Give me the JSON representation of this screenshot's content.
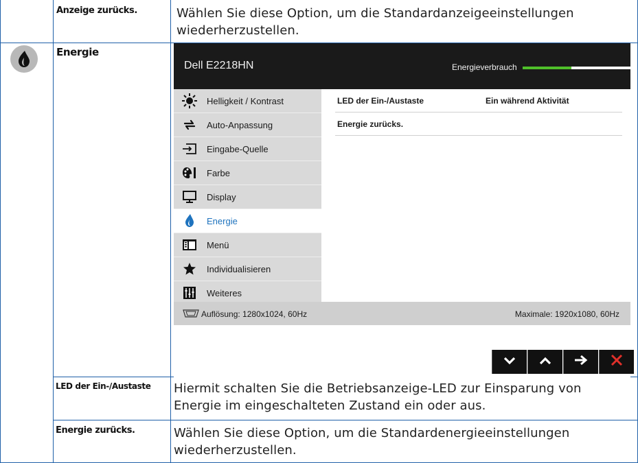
{
  "rows": {
    "reset_display": {
      "label": "Anzeige zurücks.",
      "description": "Wählen Sie diese Option, um die Standardanzeigeeinstellungen wiederherzustellen."
    },
    "energy": {
      "label": "Energie",
      "icon": "energy-flame-icon"
    },
    "power_led": {
      "label": "LED der Ein-/Austaste",
      "description": "Hiermit schalten Sie die Betriebsanzeige-LED zur Einsparung von Energie im eingeschalteten Zustand ein oder aus."
    },
    "reset_energy": {
      "label": "Energie zurücks.",
      "description": "Wählen Sie diese Option, um die Standardenergieeinstellungen wiederherzustellen."
    }
  },
  "osd": {
    "title": "Dell E2218HN",
    "usage_label": "Energieverbrauch",
    "usage_level": 0.45,
    "menu": [
      {
        "label": "Helligkeit / Kontrast",
        "icon": "brightness-icon"
      },
      {
        "label": "Auto-Anpassung",
        "icon": "auto-adjust-icon"
      },
      {
        "label": "Eingabe-Quelle",
        "icon": "input-source-icon"
      },
      {
        "label": "Farbe",
        "icon": "color-icon"
      },
      {
        "label": "Display",
        "icon": "display-icon"
      },
      {
        "label": "Energie",
        "icon": "energy-icon",
        "active": true
      },
      {
        "label": "Menü",
        "icon": "menu-icon"
      },
      {
        "label": "Individualisieren",
        "icon": "star-icon"
      },
      {
        "label": "Weiteres",
        "icon": "others-icon"
      }
    ],
    "submenu": [
      {
        "label": "LED der Ein-/Austaste",
        "value": "Ein während Aktivität"
      },
      {
        "label": "Energie zurücks.",
        "value": ""
      }
    ],
    "status_left": "Auflösung: 1280x1024, 60Hz",
    "status_right": "Maximale: 1920x1080, 60Hz",
    "nav": [
      {
        "name": "down",
        "icon": "chevron-down-icon"
      },
      {
        "name": "up",
        "icon": "chevron-up-icon"
      },
      {
        "name": "enter",
        "icon": "arrow-right-icon"
      },
      {
        "name": "exit",
        "icon": "close-icon"
      }
    ],
    "colors": {
      "active_text": "#1e73be",
      "usage_fill": "#4fc02a",
      "exit_icon": "#e0302a"
    }
  }
}
